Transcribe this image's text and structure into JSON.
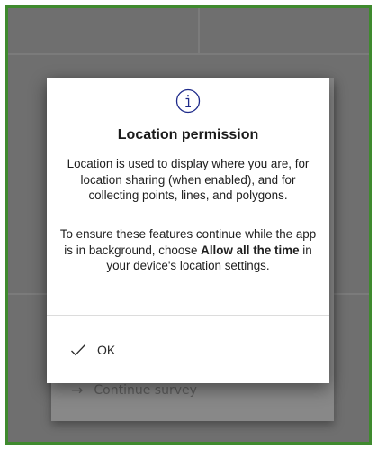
{
  "background": {
    "dialog_action_label": "Continue survey"
  },
  "dialog": {
    "title": "Location permission",
    "paragraph1": "Location is used to display where you are, for location sharing (when enabled), and for collecting points, lines, and polygons.",
    "paragraph2_before": "To ensure these features continue while the app is in background, choose ",
    "paragraph2_bold": "Allow all the time",
    "paragraph2_after": " in your device's location settings.",
    "ok_label": "OK",
    "icon": "info-icon"
  },
  "colors": {
    "frame_border": "#3f8a2e",
    "scrim": "#6f6f6f",
    "accent_icon": "#1e2a8a",
    "warning_icon": "#9a4a52"
  }
}
